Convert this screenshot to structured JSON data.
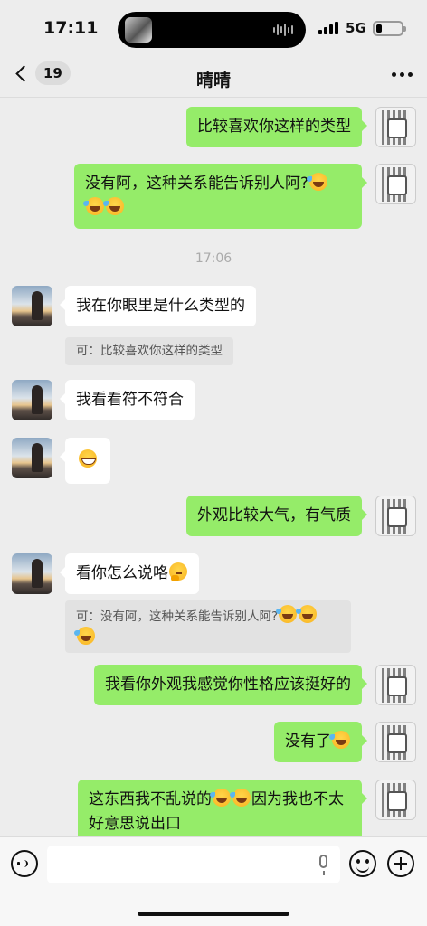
{
  "status_bar": {
    "time": "17:11",
    "network": "5G"
  },
  "nav": {
    "back_count": "19",
    "title": "晴晴"
  },
  "messages": [
    {
      "text": "比较喜欢你这样的类型"
    },
    {
      "text": "没有阿，这种关系能告诉别人阿?"
    },
    {
      "timestamp": "17:06"
    },
    {
      "text": "我在你眼里是什么类型的",
      "quote": "可：比较喜欢你这样的类型"
    },
    {
      "text": "我看看符不符合"
    },
    {
      "text": ""
    },
    {
      "text": "外观比较大气，有气质"
    },
    {
      "text": "看你怎么说咯",
      "quote": "可：没有阿，这种关系能告诉别人阿?"
    },
    {
      "text": "我看你外观我感觉你性格应该挺好的"
    },
    {
      "text": "没有了"
    },
    {
      "text_a": "这东西我不乱说的",
      "text_b": "因为我也不太好意思说出口"
    }
  ],
  "icons": {
    "emoji_laugh": "face-with-tears-of-joy",
    "emoji_grin": "grinning-face",
    "emoji_think": "thinking-face"
  },
  "colors": {
    "my_bubble": "#95ec69",
    "their_bubble": "#ffffff",
    "background": "#ededed"
  }
}
